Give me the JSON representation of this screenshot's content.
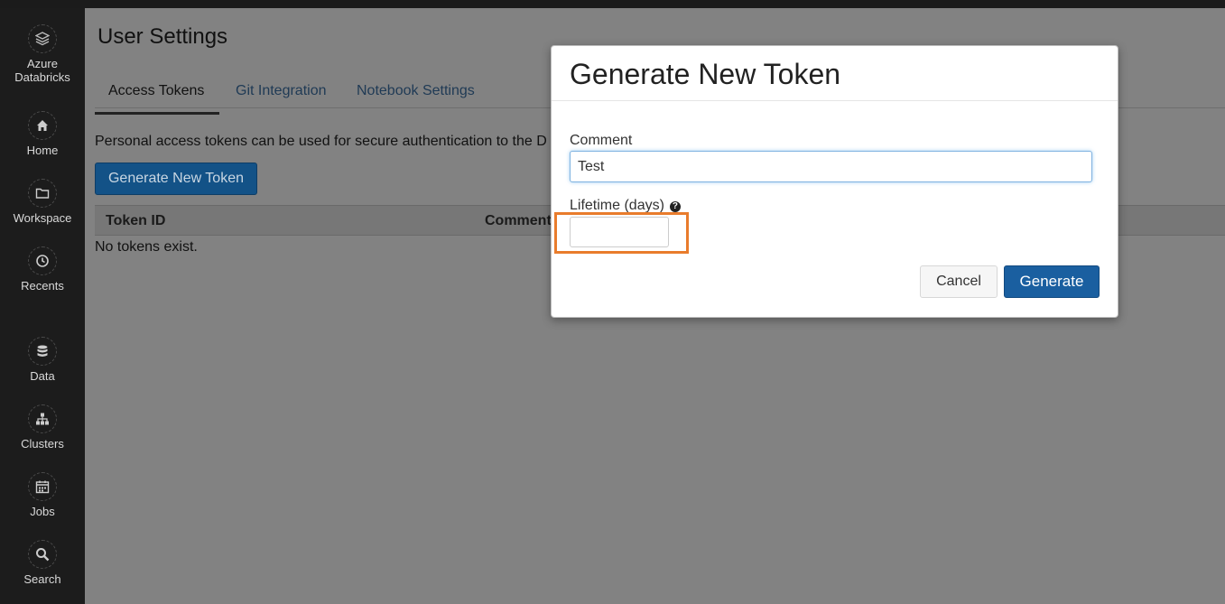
{
  "sidebar": {
    "brand_line1": "Azure",
    "brand_line2": "Databricks",
    "items": [
      {
        "label": "Home",
        "icon": "home-icon"
      },
      {
        "label": "Workspace",
        "icon": "folder-icon"
      },
      {
        "label": "Recents",
        "icon": "clock-icon"
      },
      {
        "label": "Data",
        "icon": "database-icon"
      },
      {
        "label": "Clusters",
        "icon": "cluster-icon"
      },
      {
        "label": "Jobs",
        "icon": "calendar-icon"
      },
      {
        "label": "Search",
        "icon": "search-icon"
      }
    ]
  },
  "page": {
    "title": "User Settings",
    "tabs": [
      {
        "label": "Access Tokens",
        "active": true
      },
      {
        "label": "Git Integration",
        "active": false
      },
      {
        "label": "Notebook Settings",
        "active": false
      }
    ],
    "description": "Personal access tokens can be used for secure authentication to the D",
    "generate_button": "Generate New Token",
    "table": {
      "columns": [
        "Token ID",
        "Comment"
      ],
      "empty_text": "No tokens exist."
    }
  },
  "modal": {
    "title": "Generate New Token",
    "comment_label": "Comment",
    "comment_value": "Test",
    "lifetime_label": "Lifetime (days)",
    "lifetime_value": "",
    "cancel_label": "Cancel",
    "generate_label": "Generate",
    "highlight_color": "#e97c2c",
    "primary_color": "#1a5fa0"
  }
}
